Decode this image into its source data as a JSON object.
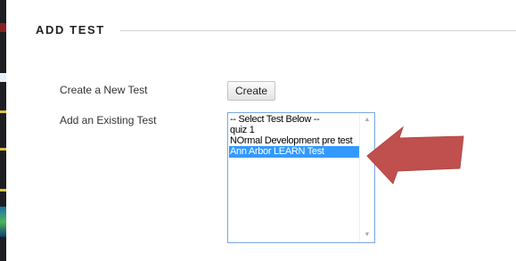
{
  "section": {
    "title": "ADD TEST"
  },
  "create_row": {
    "label": "Create a New Test",
    "button_label": "Create"
  },
  "existing_row": {
    "label": "Add an Existing Test",
    "options": [
      "-- Select Test Below --",
      "quiz 1",
      "NOrmal Development pre test",
      "Ann Arbor LEARN Test"
    ],
    "selected_option": "Ann Arbor LEARN Test",
    "scroll_up_icon": "scroll-up-arrow",
    "scroll_down_icon": "scroll-down-arrow"
  },
  "annotation": {
    "icon": "red-arrow-pointer",
    "color": "#c0504d"
  },
  "colors": {
    "selection": "#3399ff",
    "listbox_border": "#7aa7e0",
    "left_strip": "#1e1e22"
  }
}
